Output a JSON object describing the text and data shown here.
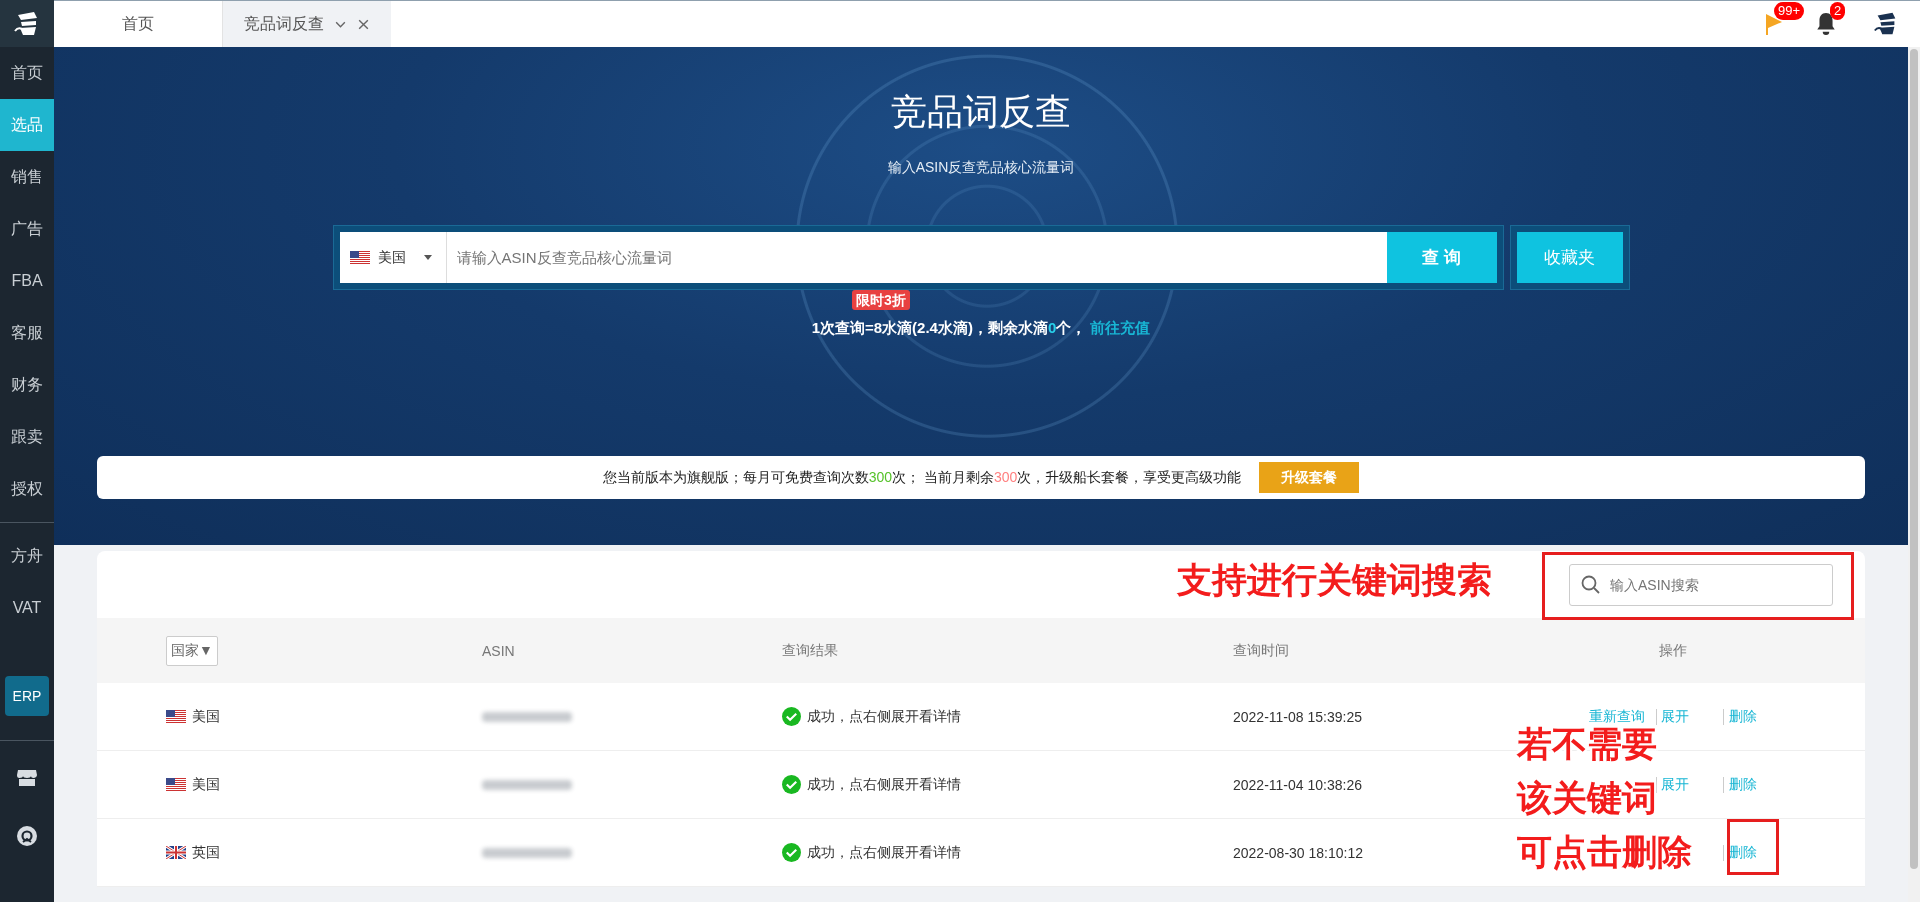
{
  "sidebar": {
    "items": [
      {
        "label": "首页",
        "selected": false
      },
      {
        "label": "选品",
        "selected": true
      },
      {
        "label": "销售",
        "selected": false
      },
      {
        "label": "广告",
        "selected": false
      },
      {
        "label": "FBA",
        "selected": false
      },
      {
        "label": "客服",
        "selected": false
      },
      {
        "label": "财务",
        "selected": false
      },
      {
        "label": "跟卖",
        "selected": false
      },
      {
        "label": "授权",
        "selected": false
      }
    ],
    "extra_items": [
      {
        "label": "方舟",
        "selected": false
      },
      {
        "label": "VAT",
        "selected": false
      }
    ],
    "erp_button": "ERP"
  },
  "tabs": [
    {
      "label": "首页",
      "selected": false
    },
    {
      "label": "竞品词反查",
      "selected": true
    }
  ],
  "header": {
    "flag_badge": "99+",
    "bell_badge": "2"
  },
  "hero": {
    "title": "竞品词反查",
    "subtitle": "输入ASIN反查竞品核心流量词",
    "country": "美国",
    "placeholder": "请输入ASIN反查竞品核心流量词",
    "search_button": "查 询",
    "favorites_button": "收藏夹",
    "promo_tag": "限时3折",
    "cost_parts": [
      {
        "text": "1次查询=8水滴(2.4水滴)，剩余水滴",
        "kind": "plain"
      },
      {
        "text": "0",
        "kind": "count"
      },
      {
        "text": "个，",
        "kind": "plain"
      }
    ],
    "recharge_link": "前往充值"
  },
  "plan_notice": {
    "parts": [
      {
        "text": "您当前版本为旗舰版；每月可免费查询次数",
        "kind": "plain"
      },
      {
        "text": "300",
        "kind": "good"
      },
      {
        "text": "次；  当前月剩余",
        "kind": "plain"
      },
      {
        "text": "300",
        "kind": "warn"
      },
      {
        "text": "次，升级船长套餐，享受更高级功能",
        "kind": "plain"
      }
    ],
    "upgrade_button": "升级套餐"
  },
  "table": {
    "search_placeholder": "输入ASIN搜索",
    "country_filter": "国家▼",
    "columns": [
      "ASIN",
      "查询结果",
      "查询时间",
      "操作"
    ],
    "rows": [
      {
        "kind": "us",
        "country": "美国",
        "result": "成功，点右侧展开看详情",
        "time": "2022-11-08 15:39:25",
        "actions": [
          {
            "label": "重新查询",
            "kind": "requery"
          },
          {
            "label": "展开",
            "kind": "expand"
          },
          {
            "label": "删除",
            "kind": "delete"
          }
        ]
      },
      {
        "kind": "us",
        "country": "美国",
        "result": "成功，点右侧展开看详情",
        "time": "2022-11-04 10:38:26",
        "actions": [
          {
            "label": "展开",
            "kind": "expand"
          },
          {
            "label": "删除",
            "kind": "delete"
          }
        ]
      },
      {
        "kind": "gb",
        "country": "英国",
        "result": "成功，点右侧展开看详情",
        "time": "2022-08-30 18:10:12",
        "actions": [
          {
            "label": "删除",
            "kind": "delete"
          }
        ]
      }
    ]
  },
  "annotations": {
    "search_hint": "支持进行关键词搜索",
    "delete_hint": [
      "若不需要",
      "该关键词",
      "可点击删除"
    ]
  }
}
